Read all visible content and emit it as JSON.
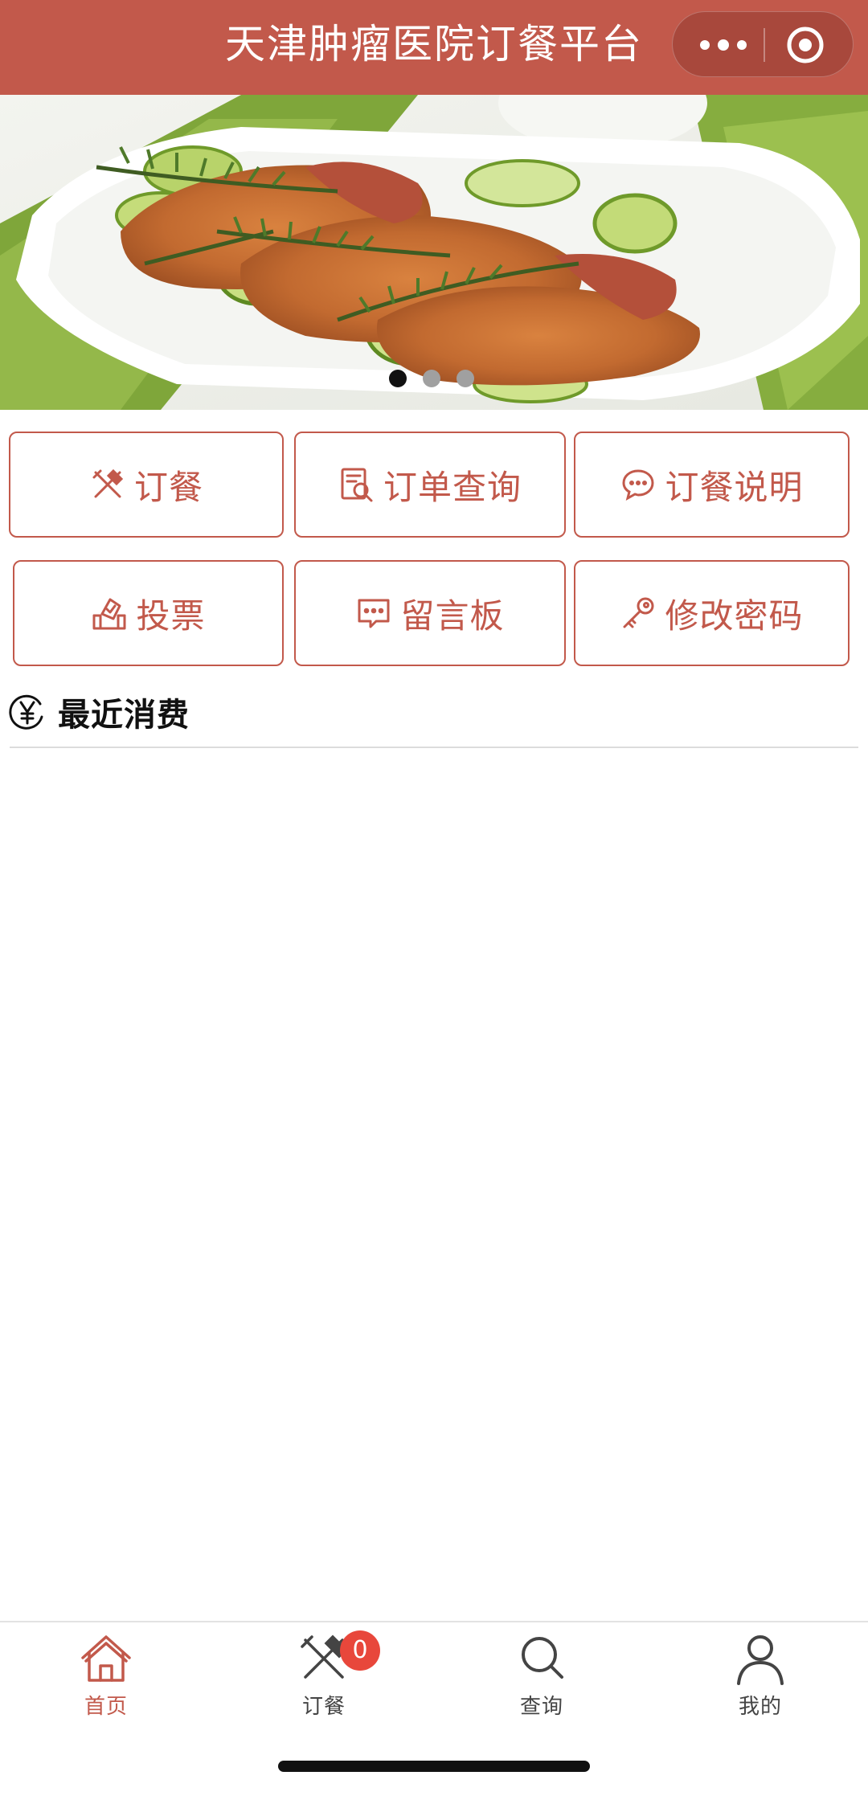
{
  "header": {
    "title": "天津肿瘤医院订餐平台",
    "bg_color": "#c2594b"
  },
  "capsule": {
    "more_icon": "more-dots-icon",
    "close_icon": "target-circle-icon"
  },
  "banner": {
    "image": "grilled-chicken-with-lime-and-rosemary",
    "slides_count": 3,
    "active_index": 0
  },
  "actions": [
    {
      "label": "订餐",
      "icon": "fork-knife-icon"
    },
    {
      "label": "订单查询",
      "icon": "order-search-icon"
    },
    {
      "label": "订餐说明",
      "icon": "chat-bubble-icon"
    },
    {
      "label": "投票",
      "icon": "vote-box-icon"
    },
    {
      "label": "留言板",
      "icon": "message-board-icon"
    },
    {
      "label": "修改密码",
      "icon": "key-icon"
    }
  ],
  "recent": {
    "title": "最近消费",
    "icon": "yen-icon"
  },
  "tabbar": {
    "items": [
      {
        "label": "首页",
        "icon": "home-icon",
        "active": true
      },
      {
        "label": "订餐",
        "icon": "fork-knife-icon",
        "badge": "0"
      },
      {
        "label": "查询",
        "icon": "search-icon"
      },
      {
        "label": "我的",
        "icon": "user-icon"
      }
    ],
    "active_color": "#c2594b",
    "inactive_color": "#444444",
    "badge_color": "#e8473b"
  },
  "accent": "#c2594b"
}
